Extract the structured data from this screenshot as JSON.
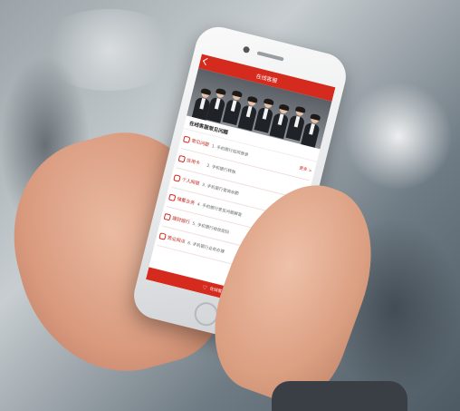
{
  "app": {
    "title": "在线客服",
    "section_title": "在线客服常见问题",
    "more_label": "更多 >"
  },
  "categories": [
    {
      "label": "常见问题",
      "question": "1. 手机银行如何登录"
    },
    {
      "label": "信用卡",
      "question": "2. 手机银行转账"
    },
    {
      "label": "个人网银",
      "question": "3. 手机银行查询余额"
    },
    {
      "label": "储蓄业务",
      "question": "4. 手机银行常见问题解答"
    },
    {
      "label": "理财银行",
      "question": "5. 手机银行修改密码"
    },
    {
      "label": "营业网点",
      "question": "6. 手机银行业务办理"
    }
  ],
  "bottom": {
    "label": "在线客服",
    "icon": "heart-icon"
  },
  "colors": {
    "accent": "#d52b1e"
  }
}
